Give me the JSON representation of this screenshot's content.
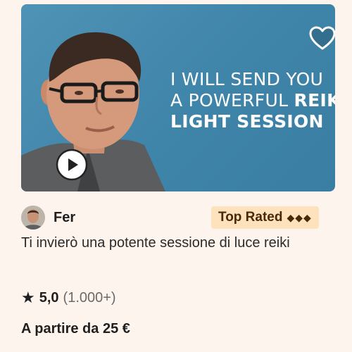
{
  "gig": {
    "thumbnail": {
      "headline_line1": "I WILL SEND YOU",
      "headline_line2_prefix": "A POWERFUL ",
      "headline_line2_bold": "REIKI",
      "headline_line3": "LIGHT SESSION",
      "background_color": "#4a8fb3"
    },
    "seller": {
      "name": "Fer",
      "badge": "Top Rated",
      "badge_diamonds": "◆◆◆"
    },
    "title": "Ti invierò una potente sessione di luce reiki",
    "rating": {
      "score": "5,0",
      "count": "(1.000+)"
    },
    "price": "A partire da 25 €"
  },
  "icons": {
    "favorite": "heart-icon",
    "play": "play-icon",
    "rating": "star-icon"
  }
}
